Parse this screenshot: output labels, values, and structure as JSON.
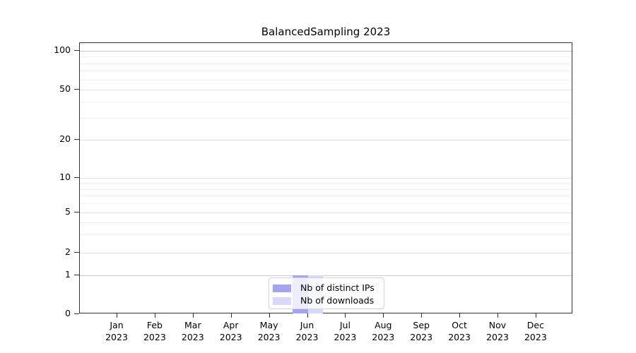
{
  "chart_data": {
    "type": "bar",
    "title": "BalancedSampling 2023",
    "categories": [
      "Jan",
      "Feb",
      "Mar",
      "Apr",
      "May",
      "Jun",
      "Jul",
      "Aug",
      "Sep",
      "Oct",
      "Nov",
      "Dec"
    ],
    "year": "2023",
    "series": [
      {
        "name": "Nb of distinct IPs",
        "color": "#a4a4f1",
        "values": [
          0,
          0,
          0,
          0,
          0,
          1,
          0,
          0,
          0,
          0,
          0,
          0
        ]
      },
      {
        "name": "Nb of downloads",
        "color": "#d8d8f8",
        "values": [
          0,
          0,
          0,
          0,
          0,
          1,
          0,
          0,
          0,
          0,
          0,
          0
        ]
      }
    ],
    "y_axis": {
      "scale": "symlog",
      "major_ticks": [
        0,
        1,
        2,
        5,
        10,
        20,
        50,
        100
      ],
      "minor_ticks": [
        3,
        4,
        6,
        7,
        8,
        9,
        30,
        40,
        60,
        70,
        80,
        90
      ],
      "emphasized_gridlines": [
        1,
        100
      ]
    },
    "x_axis": {
      "tick_count": 12
    },
    "legend": {
      "position": "lower center",
      "entries": [
        "Nb of distinct IPs",
        "Nb of downloads"
      ]
    },
    "grid": true,
    "colors": {
      "spine": "#333333",
      "gridline_major": "#e3e3e3",
      "gridline_minor": "#f1f1f1",
      "gridline_emphasized": "#c6c6c6",
      "background": "#ffffff",
      "text": "#000000"
    }
  }
}
